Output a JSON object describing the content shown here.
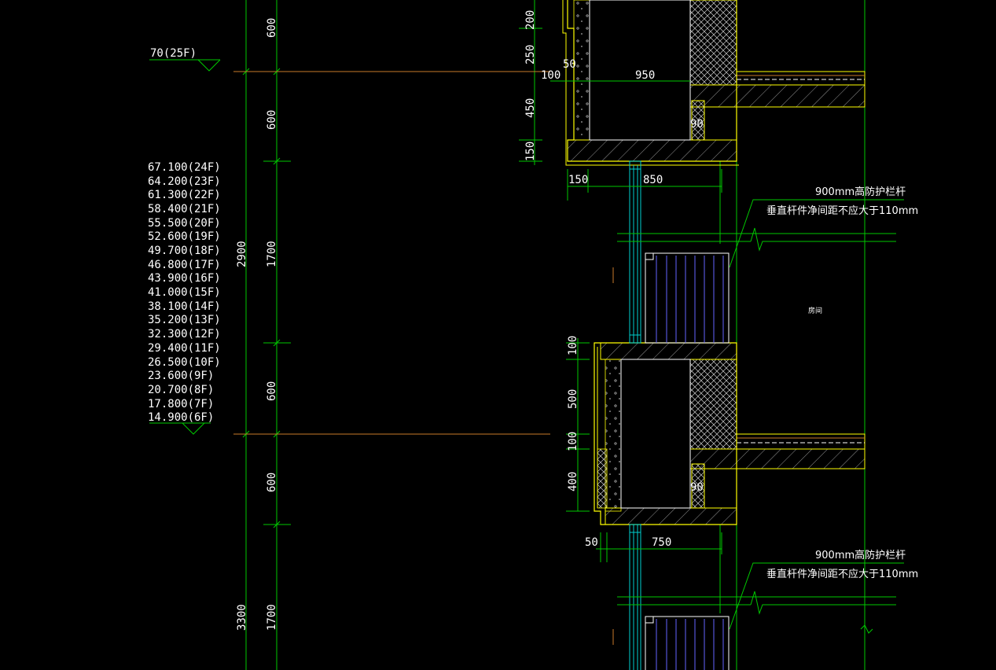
{
  "elevation_marks": {
    "top_label": "70(25F)",
    "levels": [
      "67.100(24F)",
      "64.200(23F)",
      "61.300(22F)",
      "58.400(21F)",
      "55.500(20F)",
      "52.600(19F)",
      "49.700(18F)",
      "46.800(17F)",
      "43.900(16F)",
      "41.000(15F)",
      "38.100(14F)",
      "35.200(13F)",
      "32.300(12F)",
      "29.400(11F)",
      "26.500(10F)",
      "23.600(9F)",
      "20.700(8F)",
      "17.800(7F)",
      "14.900(6F)"
    ]
  },
  "left_dimensions": {
    "storey_top": "2900",
    "storey_bottom": "3300",
    "d600_a": "600",
    "d600_b": "600",
    "d1700_a": "1700",
    "d600_c": "600",
    "d600_d": "600",
    "d1700_b": "1700"
  },
  "upper_detail": {
    "v200": "200",
    "v250": "250",
    "v450": "450",
    "v150": "150",
    "h50": "50",
    "h100": "100",
    "h950": "950",
    "h90": "90",
    "h150": "150",
    "h850": "850"
  },
  "lower_detail": {
    "v100a": "100",
    "v500": "500",
    "v100b": "100",
    "v400": "400",
    "h90": "90",
    "h50": "50",
    "h750": "750"
  },
  "notes": {
    "upper_line1": "900mm高防护栏杆",
    "upper_line2": "垂直杆件净间距不应大于110mm",
    "lower_line1": "900mm高防护栏杆",
    "lower_line2": "垂直杆件净间距不应大于110mm",
    "room": "房间"
  },
  "colors": {
    "dimension": "#00c800",
    "outline": "#ffff00",
    "hatch": "#ffffff",
    "orange": "#c87a2a",
    "glass": "#00d0d0",
    "blue": "#6464ff"
  }
}
